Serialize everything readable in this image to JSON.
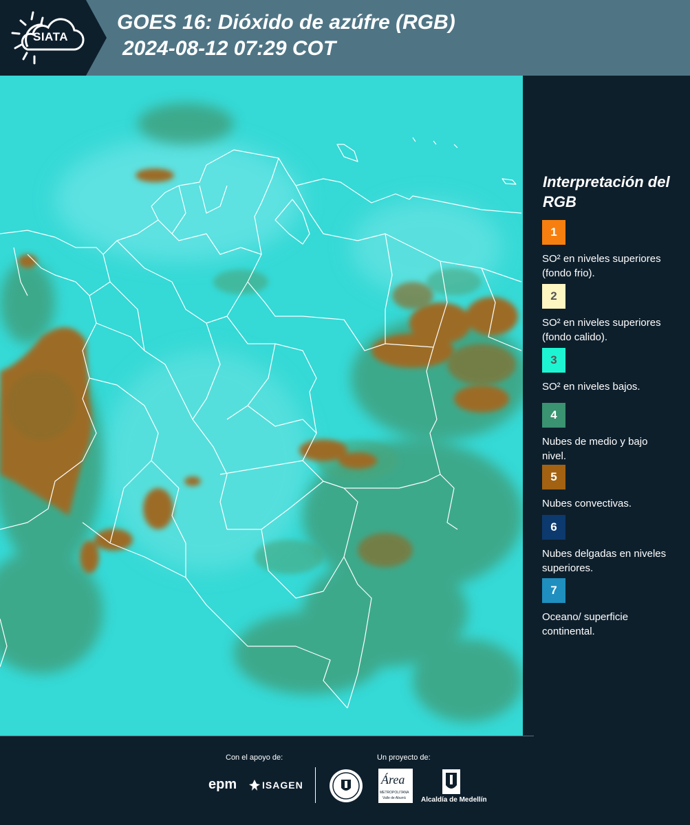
{
  "header": {
    "logo_text": "SIATA",
    "title_line1": "GOES 16: Dióxido de azúfre (RGB)",
    "title_line2": "2024-08-12 07:29 COT"
  },
  "map": {
    "kind": "satellite-image",
    "palette": {
      "background": "#35d9d6",
      "clouds_low": "#3f9a73",
      "clouds_convective": "#9c6c27",
      "borders": "#ffffff"
    }
  },
  "legend": {
    "title": "Interpretación del RGB",
    "items": [
      {
        "num": "1",
        "color": "#f77f0f",
        "text": "SO² en niveles superiores (fondo frio)."
      },
      {
        "num": "2",
        "color": "#fff7c2",
        "text": "SO² en niveles superiores (fondo calido)."
      },
      {
        "num": "3",
        "color": "#1df5d2",
        "text": "SO² en niveles bajos."
      },
      {
        "num": "4",
        "color": "#3a9371",
        "text": "Nubes de medio y bajo nivel."
      },
      {
        "num": "5",
        "color": "#a26212",
        "text": "Nubes convectivas."
      },
      {
        "num": "6",
        "color": "#0c3a6e",
        "text": "Nubes delgadas en niveles superiores."
      },
      {
        "num": "7",
        "color": "#1f8fbf",
        "text": "Oceano/ superficie continental."
      }
    ]
  },
  "footer": {
    "support_label": "Con el apoyo de:",
    "project_label": "Un proyecto de:",
    "epm": "epm",
    "isagen": "ISAGEN",
    "area_metro_main": "Área",
    "area_metro_sub1": "METROPOLITANA",
    "area_metro_sub2": "Valle de Aburrá",
    "alcaldia": "Alcaldía de Medellín"
  }
}
